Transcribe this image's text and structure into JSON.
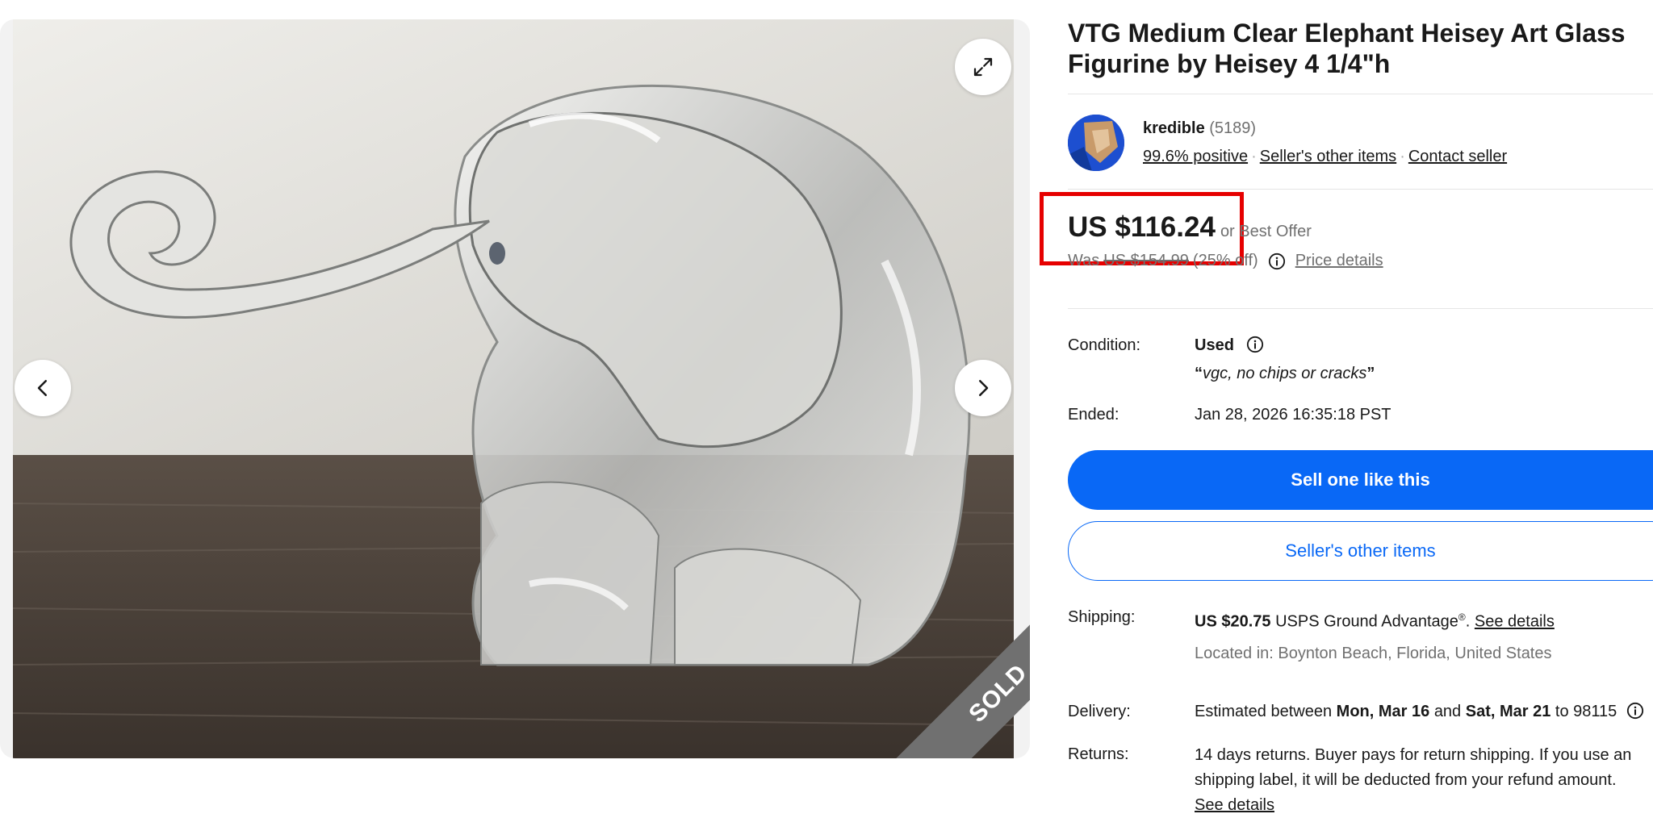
{
  "listing": {
    "title": "VTG Medium Clear Elephant Heisey Art Glass Figurine by Heisey 4 1/4\"h",
    "sold_label": "SOLD"
  },
  "seller": {
    "name": "kredible",
    "feedback_count": "(5189)",
    "positive": "99.6% positive",
    "other_items_link": "Seller's other items",
    "contact_link": "Contact seller"
  },
  "price": {
    "current": "US $116.24",
    "best_offer": "or Best Offer",
    "was_label": "Was",
    "was_price": "US $154.99",
    "discount": "(25% off)",
    "details_link": "Price details"
  },
  "condition": {
    "label": "Condition:",
    "value": "Used",
    "note_open": "“",
    "note": "vgc, no chips or cracks",
    "note_close": "”"
  },
  "ended": {
    "label": "Ended:",
    "value": "Jan 28, 2026 16:35:18 PST"
  },
  "actions": {
    "sell_like": "Sell one like this",
    "seller_items": "Seller's other items"
  },
  "shipping": {
    "label": "Shipping:",
    "price": "US $20.75",
    "method": "USPS Ground Advantage",
    "reg": "®",
    "period": ".",
    "details_link": "See details",
    "location": "Located in: Boynton Beach, Florida, United States"
  },
  "delivery": {
    "label": "Delivery:",
    "prefix": "Estimated between",
    "start": "Mon, Mar 16",
    "and": "and",
    "end": "Sat, Mar 21",
    "to": "to 98115"
  },
  "returns": {
    "label": "Returns:",
    "line1": "14 days returns. Buyer pays for return shipping. If you use an",
    "line2": "shipping label, it will be deducted from your refund amount.",
    "line3": "See details"
  },
  "colors": {
    "primary": "#0968f6",
    "sold_ribbon": "#707070",
    "highlight": "#e60000"
  }
}
